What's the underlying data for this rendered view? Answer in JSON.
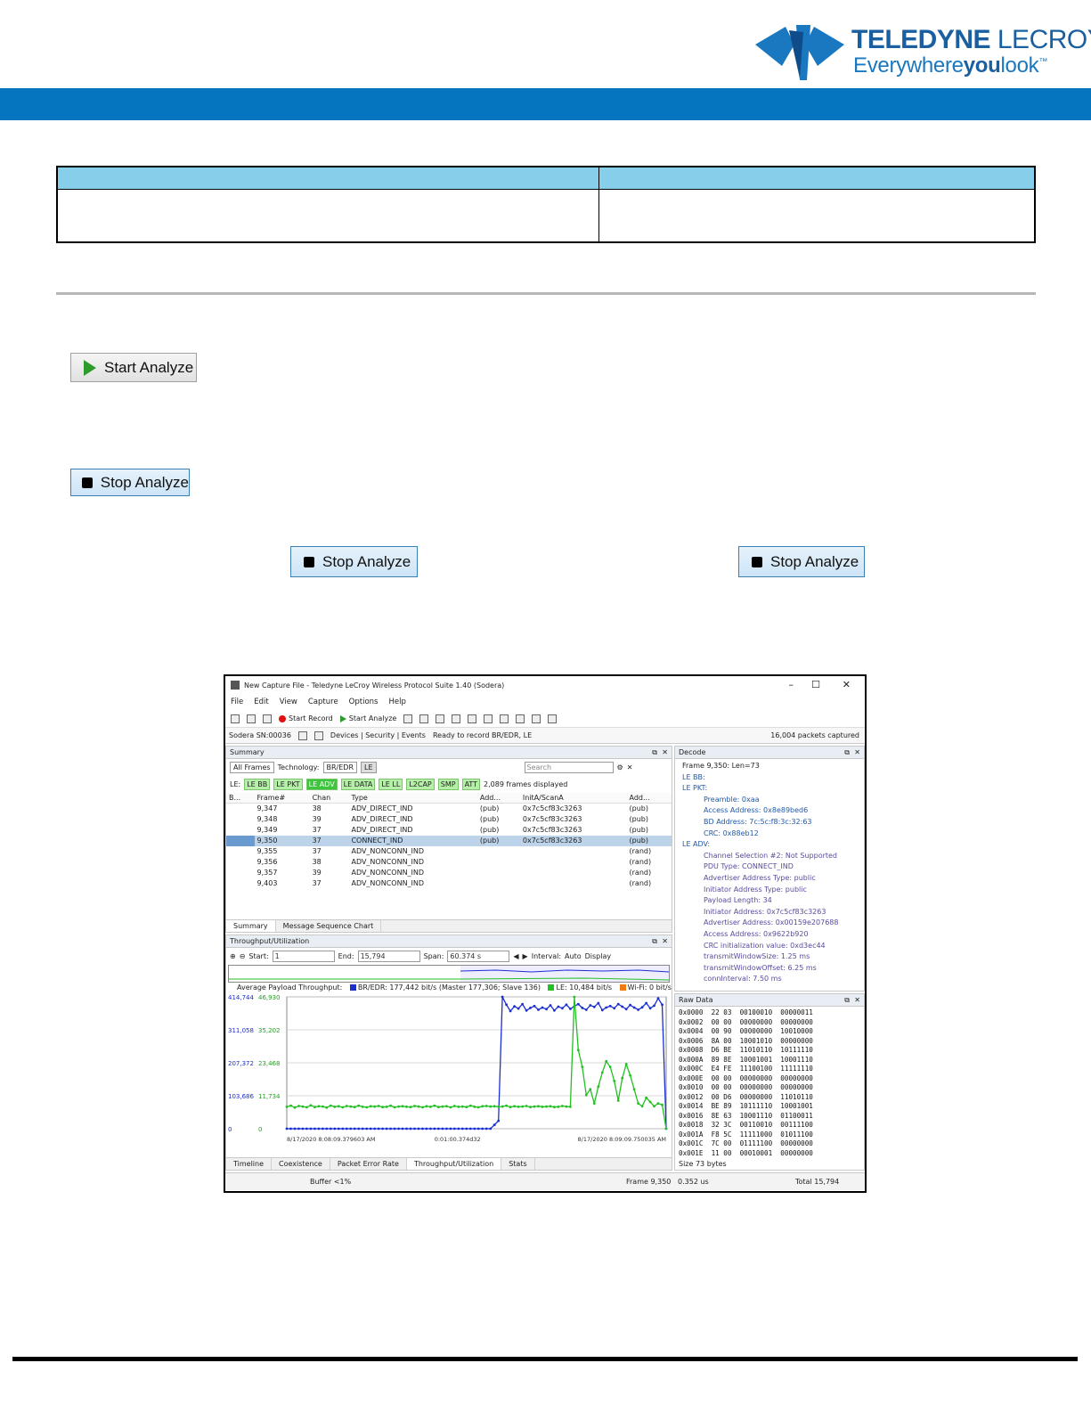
{
  "header": {
    "brand_primary": "TELEDYNE",
    "brand_secondary": "LECROY",
    "tagline_a": "Everywhere",
    "tagline_b": "you",
    "tagline_c": "look",
    "tagline_tm": "™",
    "band_color": "#0675c0"
  },
  "buttons": {
    "start_analyze": "Start Analyze",
    "stop_analyze_1": "Stop Analyze",
    "stop_analyze_2": "Stop Analyze",
    "stop_analyze_3": "Stop Analyze"
  },
  "app": {
    "window_title": "New Capture File - Teledyne LeCroy Wireless Protocol Suite 1.40 (Sodera)",
    "window_controls": [
      "–",
      "☐",
      "✕"
    ],
    "menu": [
      "File",
      "Edit",
      "View",
      "Capture",
      "Options",
      "Help"
    ],
    "toolbar": {
      "start_record": "Start Record",
      "start_analyze": "Start Analyze"
    },
    "status": {
      "device": "Sodera SN:00036",
      "links": "Devices | Security | Events",
      "ready": "Ready to record BR/EDR, LE",
      "captured": "16,004 packets captured"
    },
    "summary": {
      "title": "Summary",
      "all_frames": "All Frames",
      "technology_label": "Technology:",
      "tech_chips": [
        "BR/EDR",
        "LE"
      ],
      "search_placeholder": "Search",
      "le_label": "LE:",
      "le_chips": [
        "LE BB",
        "LE PKT",
        "LE ADV",
        "LE DATA",
        "LE LL",
        "L2CAP",
        "SMP",
        "ATT"
      ],
      "frames_displayed": "2,089 frames displayed",
      "columns": [
        "B...",
        "Frame#",
        "Chan",
        "Type",
        "Add...",
        "InitA/ScanA",
        "Add..."
      ],
      "rows": [
        [
          "",
          "9,347",
          "38",
          "ADV_DIRECT_IND",
          "(pub)",
          "0x7c5cf83c3263",
          "(pub)"
        ],
        [
          "",
          "9,348",
          "39",
          "ADV_DIRECT_IND",
          "(pub)",
          "0x7c5cf83c3263",
          "(pub)"
        ],
        [
          "",
          "9,349",
          "37",
          "ADV_DIRECT_IND",
          "(pub)",
          "0x7c5cf83c3263",
          "(pub)"
        ],
        [
          "",
          "9,350",
          "37",
          "CONNECT_IND",
          "(pub)",
          "0x7c5cf83c3263",
          "(pub)"
        ],
        [
          "",
          "9,355",
          "37",
          "ADV_NONCONN_IND",
          "",
          "",
          "(rand)"
        ],
        [
          "",
          "9,356",
          "38",
          "ADV_NONCONN_IND",
          "",
          "",
          "(rand)"
        ],
        [
          "",
          "9,357",
          "39",
          "ADV_NONCONN_IND",
          "",
          "",
          "(rand)"
        ],
        [
          "",
          "9,403",
          "37",
          "ADV_NONCONN_IND",
          "",
          "",
          "(rand)"
        ]
      ],
      "tabs": [
        "Summary",
        "Message Sequence Chart"
      ]
    },
    "decode": {
      "title": "Decode",
      "lines": [
        "Frame 9,350:  Len=73",
        "LE BB:",
        "LE PKT:",
        "Preamble: 0xaa",
        "Access Address: 0x8e89bed6",
        "BD Address: 7c:5c:f8:3c:32:63",
        "CRC: 0x88eb12",
        "LE ADV:",
        "Channel Selection #2: Not Supported",
        "PDU Type: CONNECT_IND",
        "Advertiser Address Type: public",
        "Initiator Address Type: public",
        "Payload Length: 34",
        "Initiator Address: 0x7c5cf83c3263",
        "Advertiser Address: 0x00159e207688",
        "Access Address: 0x9622b920",
        "CRC initialization value: 0xd3ec44",
        "transmitWindowSize: 1.25  ms",
        "transmitWindowOffset: 6.25  ms",
        "connInterval: 7.50  ms"
      ]
    },
    "raw": {
      "title": "Raw Data",
      "lines": [
        "0x0000  22 03  00100010  00000011",
        "0x0002  00 00  00000000  00000000",
        "0x0004  00 90  00000000  10010000",
        "0x0006  8A 00  10001010  00000000",
        "0x0008  D6 BE  11010110  10111110",
        "0x000A  89 8E  10001001  10001110",
        "0x000C  E4 FE  11100100  11111110",
        "0x000E  00 00  00000000  00000000",
        "0x0010  00 00  00000000  00000000",
        "0x0012  00 D6  00000000  11010110",
        "0x0014  BE 89  10111110  10001001",
        "0x0016  8E 63  10001110  01100011",
        "0x0018  32 3C  00110010  00111100",
        "0x001A  F8 5C  11111000  01011100",
        "0x001C  7C 00  01111100  00000000",
        "0x001E  11 00  00010001  00000000"
      ],
      "size": "Size 73 bytes"
    },
    "throughput": {
      "title": "Throughput/Utilization",
      "start_label": "Start:",
      "start_value": "1",
      "end_label": "End:",
      "end_value": "15,794",
      "span_label": "Span:",
      "span_value": "60.374 s",
      "interval_label": "Interval:",
      "interval_value": "Auto",
      "display_label": "Display",
      "legend_title": "Average Payload Throughput:",
      "legend_bredr": "BR/EDR: 177,442 bit/s (Master 177,306; Slave 136)",
      "legend_le": "LE: 10,484 bit/s",
      "legend_wifi": "Wi-Fi: 0 bit/s",
      "time_left": "8/17/2020 8:08:09.379603 AM",
      "time_mid": "0:01:00.374d32",
      "time_right": "8/17/2020 8:09:09.750035 AM",
      "tabs": [
        "Timeline",
        "Coexistence",
        "Packet Error Rate",
        "Throughput/Utilization",
        "Stats"
      ]
    },
    "footer": {
      "buffer": "Buffer <1%",
      "frame": "Frame 9,350",
      "time": "0.352 us",
      "total": "Total 15,794"
    }
  },
  "chart_data": {
    "type": "line",
    "title": "",
    "xlabel": "",
    "ylabel": "",
    "y_left_ticks": [
      "414,744",
      "311,058",
      "207,372",
      "103,686",
      "0"
    ],
    "y_right_ticks": [
      "46,930",
      "35,202",
      "23,468",
      "11,734",
      "0"
    ],
    "x_ticks": [
      "8/17/2020 8:08:09.379603 AM",
      "0:01:00.374d32",
      "8/17/2020 8:09:09.750035 AM"
    ],
    "series": [
      {
        "name": "BR/EDR",
        "color": "#1a2fd0",
        "values": [
          0,
          0,
          0,
          0,
          0,
          0,
          0,
          0,
          0,
          0,
          0,
          0,
          0,
          0,
          0,
          0,
          0,
          0,
          0,
          0,
          0,
          0,
          0,
          0,
          0,
          0,
          0,
          0,
          0,
          0,
          0,
          0,
          0,
          0,
          0,
          0,
          0,
          0,
          0,
          0,
          0,
          0,
          0,
          0,
          0,
          0,
          0,
          0,
          0,
          0,
          0,
          0,
          12000,
          25000,
          414744,
          390000,
          370000,
          385000,
          378000,
          392000,
          372000,
          380000,
          386000,
          374000,
          381000,
          376000,
          388000,
          372000,
          384000,
          379000,
          390000,
          377000,
          385000,
          392000,
          380000,
          374000,
          388000,
          383000,
          395000,
          373000,
          381000,
          386000,
          379000,
          392000,
          384000,
          376000,
          389000,
          381000,
          374000,
          382000,
          395000,
          379000,
          387000,
          410000,
          390000,
          0
        ]
      },
      {
        "name": "LE",
        "color": "#22c022",
        "values": [
          7800,
          8200,
          7500,
          8100,
          7900,
          7600,
          8300,
          7700,
          8000,
          7900,
          7500,
          8200,
          7800,
          8000,
          7600,
          8100,
          7900,
          7700,
          8200,
          7800,
          7600,
          8000,
          7900,
          8100,
          7700,
          7800,
          8200,
          7600,
          7900,
          8000,
          7800,
          7700,
          8100,
          7900,
          7600,
          8000,
          7800,
          8200,
          7700,
          7900,
          8000,
          7600,
          8100,
          7800,
          7900,
          7700,
          8200,
          7800,
          7600,
          8000,
          8100,
          7900,
          8000,
          7800,
          7900,
          8200,
          7700,
          8000,
          7800,
          7900,
          8100,
          7700,
          7900,
          8000,
          7800,
          7900,
          8000,
          7700,
          7800,
          8100,
          7900,
          7800,
          46930,
          28000,
          22000,
          12000,
          14000,
          9000,
          15000,
          20000,
          24000,
          22000,
          17000,
          10000,
          18000,
          23000,
          19000,
          14000,
          9000,
          8000,
          11000,
          9500,
          8000,
          9000,
          8500,
          0
        ]
      }
    ]
  }
}
